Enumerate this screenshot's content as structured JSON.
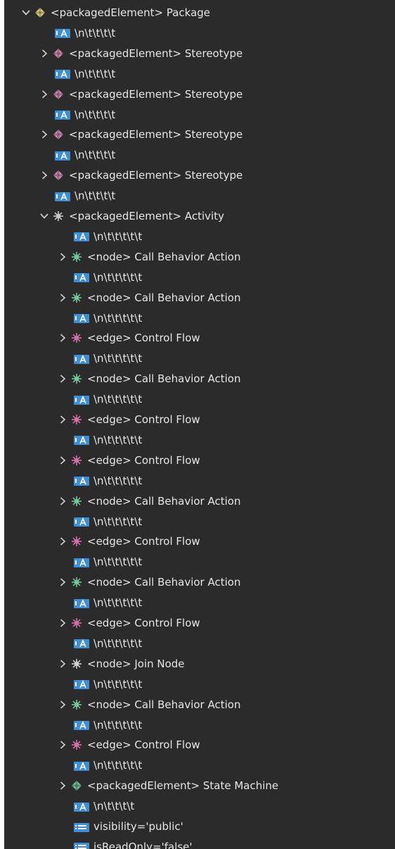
{
  "colors": {
    "background": "#2b2b2b",
    "text": "#e6e6e6",
    "chevron": "#cfcfcf",
    "package_icon": "#e8d87c",
    "stereotype_icon": "#d889b5",
    "activity_icon": "#c8c8c8",
    "node_icon": "#6fc79a",
    "edge_icon": "#d46fa7",
    "join_icon": "#cfcfcf",
    "state_machine_icon": "#6fc79a",
    "text_icon": "#3c8fd6",
    "attr_icon": "#7fb7e8"
  },
  "rows": [
    {
      "label": "<packagedElement> Package",
      "icon": "package-icon",
      "expanded": true
    },
    {
      "label": "\\n\\t\\t\\t\\t",
      "icon": "text-node-icon"
    },
    {
      "label": "<packagedElement> Stereotype",
      "icon": "stereotype-icon",
      "expanded": false
    },
    {
      "label": "\\n\\t\\t\\t\\t",
      "icon": "text-node-icon"
    },
    {
      "label": "<packagedElement> Stereotype",
      "icon": "stereotype-icon",
      "expanded": false
    },
    {
      "label": "\\n\\t\\t\\t\\t",
      "icon": "text-node-icon"
    },
    {
      "label": "<packagedElement> Stereotype",
      "icon": "stereotype-icon",
      "expanded": false
    },
    {
      "label": "\\n\\t\\t\\t\\t",
      "icon": "text-node-icon"
    },
    {
      "label": "<packagedElement> Stereotype",
      "icon": "stereotype-icon",
      "expanded": false
    },
    {
      "label": "\\n\\t\\t\\t\\t",
      "icon": "text-node-icon"
    },
    {
      "label": "<packagedElement> Activity",
      "icon": "activity-icon",
      "expanded": true
    },
    {
      "label": "\\n\\t\\t\\t\\t\\t",
      "icon": "text-node-icon"
    },
    {
      "label": "<node> Call Behavior Action",
      "icon": "node-icon",
      "expanded": false
    },
    {
      "label": "\\n\\t\\t\\t\\t\\t",
      "icon": "text-node-icon"
    },
    {
      "label": "<node> Call Behavior Action",
      "icon": "node-icon",
      "expanded": false
    },
    {
      "label": "\\n\\t\\t\\t\\t\\t",
      "icon": "text-node-icon"
    },
    {
      "label": "<edge> Control Flow",
      "icon": "edge-icon",
      "expanded": false
    },
    {
      "label": "\\n\\t\\t\\t\\t\\t",
      "icon": "text-node-icon"
    },
    {
      "label": "<node> Call Behavior Action",
      "icon": "node-icon",
      "expanded": false
    },
    {
      "label": "\\n\\t\\t\\t\\t\\t",
      "icon": "text-node-icon"
    },
    {
      "label": "<edge> Control Flow",
      "icon": "edge-icon",
      "expanded": false
    },
    {
      "label": "\\n\\t\\t\\t\\t\\t",
      "icon": "text-node-icon"
    },
    {
      "label": "<edge> Control Flow",
      "icon": "edge-icon",
      "expanded": false
    },
    {
      "label": "\\n\\t\\t\\t\\t\\t",
      "icon": "text-node-icon"
    },
    {
      "label": "<node> Call Behavior Action",
      "icon": "node-icon",
      "expanded": false
    },
    {
      "label": "\\n\\t\\t\\t\\t\\t",
      "icon": "text-node-icon"
    },
    {
      "label": "<edge> Control Flow",
      "icon": "edge-icon",
      "expanded": false
    },
    {
      "label": "\\n\\t\\t\\t\\t\\t",
      "icon": "text-node-icon"
    },
    {
      "label": "<node> Call Behavior Action",
      "icon": "node-icon",
      "expanded": false
    },
    {
      "label": "\\n\\t\\t\\t\\t\\t",
      "icon": "text-node-icon"
    },
    {
      "label": "<edge> Control Flow",
      "icon": "edge-icon",
      "expanded": false
    },
    {
      "label": "\\n\\t\\t\\t\\t\\t",
      "icon": "text-node-icon"
    },
    {
      "label": "<node> Join Node",
      "icon": "join-node-icon",
      "expanded": false
    },
    {
      "label": "\\n\\t\\t\\t\\t\\t",
      "icon": "text-node-icon"
    },
    {
      "label": "<node> Call Behavior Action",
      "icon": "node-icon",
      "expanded": false
    },
    {
      "label": "\\n\\t\\t\\t\\t\\t",
      "icon": "text-node-icon"
    },
    {
      "label": "<edge> Control Flow",
      "icon": "edge-icon",
      "expanded": false
    },
    {
      "label": "\\n\\t\\t\\t\\t\\t",
      "icon": "text-node-icon"
    },
    {
      "label": "<packagedElement> State Machine",
      "icon": "state-machine-icon",
      "expanded": false
    },
    {
      "label": "\\n\\t\\t\\t\\t",
      "icon": "text-node-icon"
    },
    {
      "label": "visibility='public'",
      "icon": "attribute-icon"
    },
    {
      "label": "isReadOnly='false'",
      "icon": "attribute-icon"
    }
  ]
}
